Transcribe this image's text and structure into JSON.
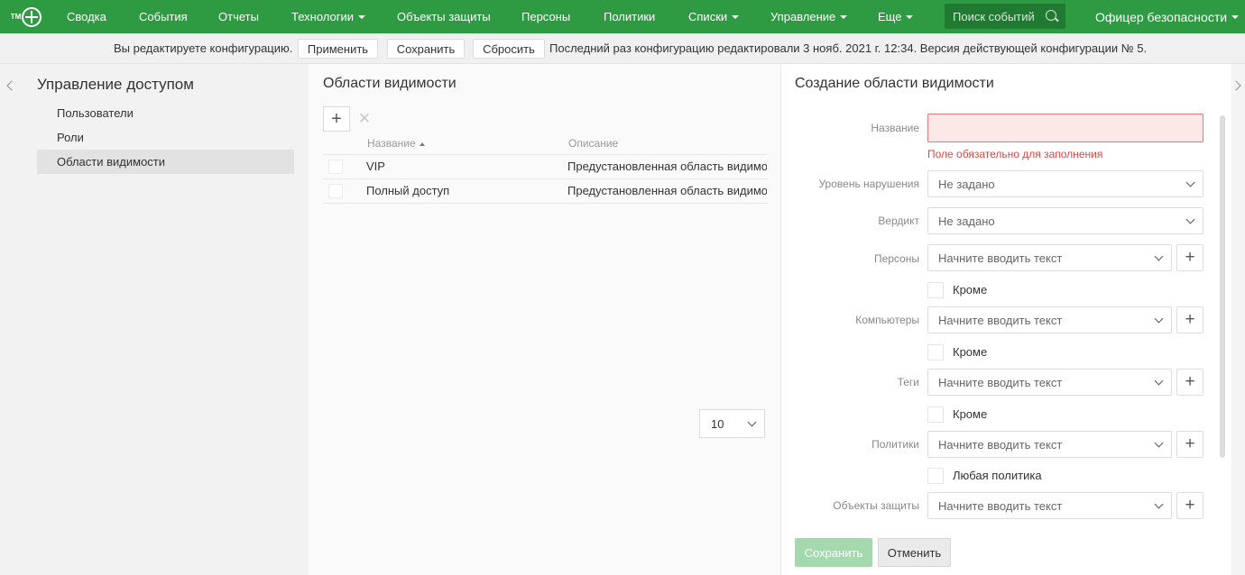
{
  "colors": {
    "brand": "#2e9a42",
    "error": "#e04545",
    "save_disabled": "#a3d9ad"
  },
  "logo": {
    "tm": "TM"
  },
  "nav": {
    "items": [
      {
        "label": "Сводка",
        "dropdown": false
      },
      {
        "label": "События",
        "dropdown": false
      },
      {
        "label": "Отчеты",
        "dropdown": false
      },
      {
        "label": "Технологии",
        "dropdown": true
      },
      {
        "label": "Объекты защиты",
        "dropdown": false
      },
      {
        "label": "Персоны",
        "dropdown": false
      },
      {
        "label": "Политики",
        "dropdown": false
      },
      {
        "label": "Списки",
        "dropdown": true
      },
      {
        "label": "Управление",
        "dropdown": true
      },
      {
        "label": "Еще",
        "dropdown": true
      }
    ],
    "search_placeholder": "Поиск событий",
    "search_icon": "search-icon",
    "user": "Офицер безопасности"
  },
  "config_bar": {
    "editing_text": "Вы редактируете конфигурацию.",
    "apply": "Применить",
    "save": "Сохранить",
    "reset": "Сбросить",
    "last_edit": "Последний раз конфигурацию редактировали 3 нояб. 2021 г. 12:34. Версия действующей конфигурации № 5."
  },
  "left_panel": {
    "title": "Управление доступом",
    "items": [
      {
        "label": "Пользователи",
        "active": false
      },
      {
        "label": "Роли",
        "active": false
      },
      {
        "label": "Области видимости",
        "active": true
      }
    ]
  },
  "middle_panel": {
    "title": "Области видимости",
    "add_icon": "plus-icon",
    "delete_icon": "close-icon",
    "columns": {
      "name": "Название",
      "description": "Описание"
    },
    "sort": "name-ascending",
    "rows": [
      {
        "name": "VIP",
        "description": "Предустановленная область видимости"
      },
      {
        "name": "Полный доступ",
        "description": "Предустановленная область видимости"
      }
    ],
    "page_size": "10"
  },
  "right_panel": {
    "title": "Создание области видимости",
    "fields": {
      "name_label": "Название",
      "name_value": "",
      "name_error": "Поле обязательно для заполнения",
      "violation_label": "Уровень нарушения",
      "violation_value": "Не задано",
      "verdict_label": "Вердикт",
      "verdict_value": "Не задано",
      "persons_label": "Персоны",
      "persons_placeholder": "Начните вводить текст",
      "persons_except": "Кроме",
      "computers_label": "Компьютеры",
      "computers_placeholder": "Начните вводить текст",
      "computers_except": "Кроме",
      "tags_label": "Теги",
      "tags_placeholder": "Начните вводить текст",
      "tags_except": "Кроме",
      "policies_label": "Политики",
      "policies_placeholder": "Начните вводить текст",
      "any_policy": "Любая политика",
      "objects_label": "Объекты защиты",
      "objects_placeholder": "Начните вводить текст"
    },
    "buttons": {
      "save": "Сохранить",
      "cancel": "Отменить"
    }
  }
}
